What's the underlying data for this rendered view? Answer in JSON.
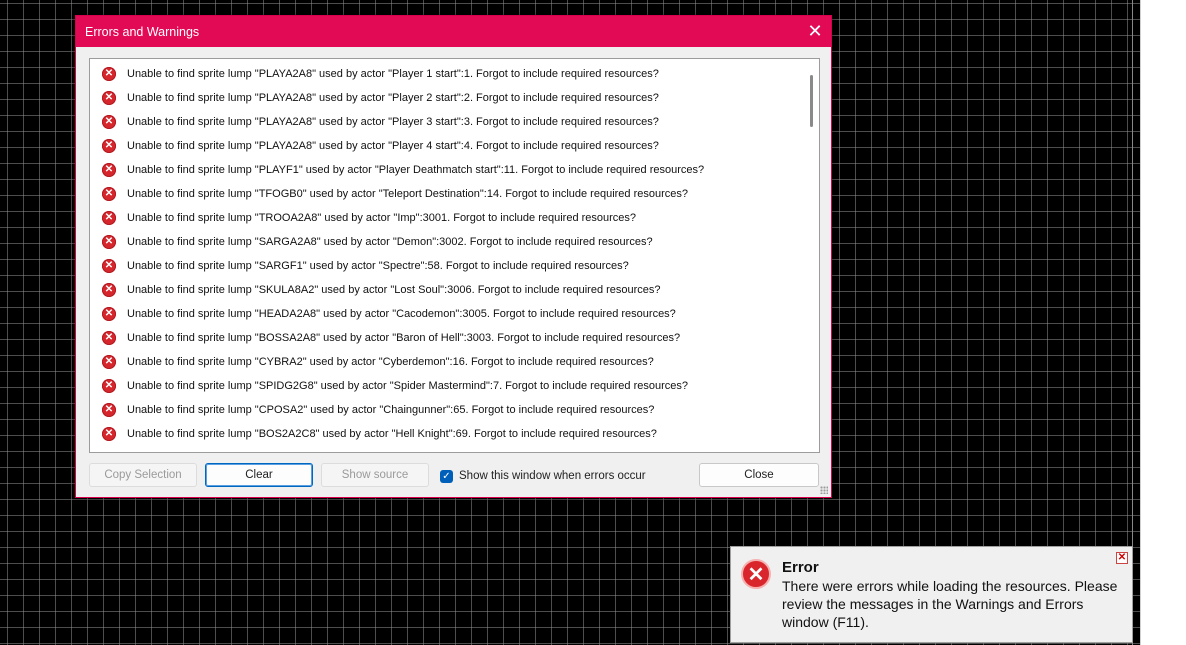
{
  "dialog": {
    "title": "Errors and Warnings",
    "close_glyph": "✕",
    "messages": [
      "Unable to find sprite lump \"PLAYA2A8\" used by actor \"Player 1 start\":1. Forgot to include required resources?",
      "Unable to find sprite lump \"PLAYA2A8\" used by actor \"Player 2 start\":2. Forgot to include required resources?",
      "Unable to find sprite lump \"PLAYA2A8\" used by actor \"Player 3 start\":3. Forgot to include required resources?",
      "Unable to find sprite lump \"PLAYA2A8\" used by actor \"Player 4 start\":4. Forgot to include required resources?",
      "Unable to find sprite lump \"PLAYF1\" used by actor \"Player Deathmatch start\":11. Forgot to include required resources?",
      "Unable to find sprite lump \"TFOGB0\" used by actor \"Teleport Destination\":14. Forgot to include required resources?",
      "Unable to find sprite lump \"TROOA2A8\" used by actor \"Imp\":3001. Forgot to include required resources?",
      "Unable to find sprite lump \"SARGA2A8\" used by actor \"Demon\":3002. Forgot to include required resources?",
      "Unable to find sprite lump \"SARGF1\" used by actor \"Spectre\":58. Forgot to include required resources?",
      "Unable to find sprite lump \"SKULA8A2\" used by actor \"Lost Soul\":3006. Forgot to include required resources?",
      "Unable to find sprite lump \"HEADA2A8\" used by actor \"Cacodemon\":3005. Forgot to include required resources?",
      "Unable to find sprite lump \"BOSSA2A8\" used by actor \"Baron of Hell\":3003. Forgot to include required resources?",
      "Unable to find sprite lump \"CYBRA2\" used by actor \"Cyberdemon\":16. Forgot to include required resources?",
      "Unable to find sprite lump \"SPIDG2G8\" used by actor \"Spider Mastermind\":7. Forgot to include required resources?",
      "Unable to find sprite lump \"CPOSA2\" used by actor \"Chaingunner\":65. Forgot to include required resources?",
      "Unable to find sprite lump \"BOS2A2C8\" used by actor \"Hell Knight\":69. Forgot to include required resources?"
    ],
    "buttons": {
      "copy_selection": "Copy Selection",
      "clear": "Clear",
      "show_source": "Show source",
      "close": "Close"
    },
    "checkbox": {
      "label": "Show this window when errors occur",
      "checked": true
    }
  },
  "toast": {
    "title": "Error",
    "message": "There were errors while loading the resources. Please review the messages in the Warnings and Errors window (F11).",
    "icon": "error-icon",
    "close_glyph": "✕"
  },
  "colors": {
    "titlebar": "#e30a55",
    "error_icon": "#d6262c",
    "checkbox": "#005fb8"
  }
}
